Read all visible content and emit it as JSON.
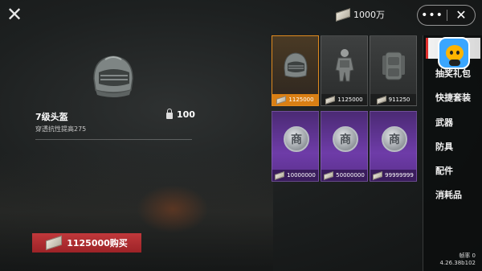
{
  "header": {
    "close_icon": "close-icon",
    "currency_amount": "1000万",
    "more_glyph": "•••",
    "pill_close_glyph": "✕"
  },
  "detail": {
    "name": "7级头盔",
    "description": "穿透抗性提高275",
    "weight": "100",
    "buy_label": "1125000购买"
  },
  "shop_items": [
    {
      "price": "1125000",
      "icon": "helmet-icon",
      "style": "gold"
    },
    {
      "price": "1125000",
      "icon": "armor-suit-icon",
      "style": "gray"
    },
    {
      "price": "911250",
      "icon": "backpack-icon",
      "style": "gray"
    },
    {
      "price": "10000000",
      "icon": "coin-icon",
      "style": "purple"
    },
    {
      "price": "50000000",
      "icon": "coin-icon",
      "style": "purple"
    },
    {
      "price": "99999999",
      "icon": "coin-icon",
      "style": "purple"
    }
  ],
  "coin_glyph": "商",
  "sidebar": {
    "items": [
      "新",
      "抽奖礼包",
      "快捷套装",
      "武器",
      "防具",
      "配件",
      "消耗品"
    ]
  },
  "footer": {
    "fps": "帧率 0",
    "version": "4.26.38b102"
  },
  "colors": {
    "accent_orange": "#d97f14",
    "buy_red": "#b02d31",
    "purple_card": "#6e3ca8"
  }
}
